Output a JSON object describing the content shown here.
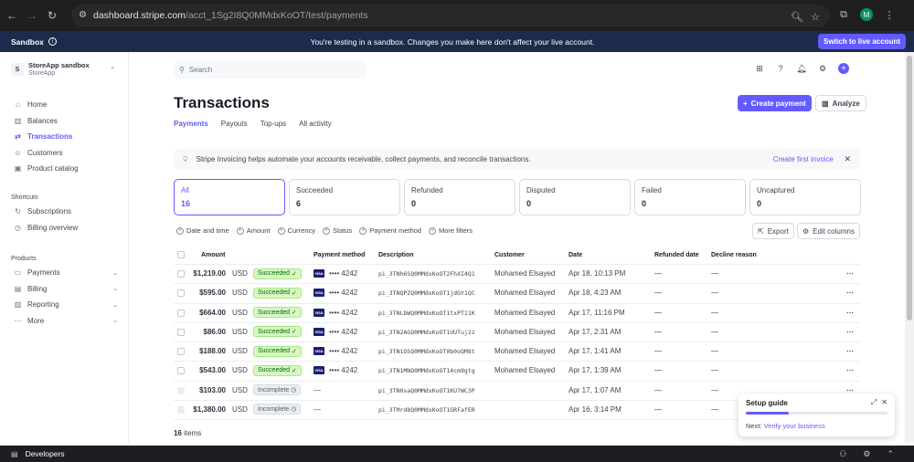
{
  "browser": {
    "url_host": "dashboard.stripe.com",
    "url_path": "/acct_1Sg2I8Q0MMdxKoOT/test/payments",
    "profile_initial": "M"
  },
  "sandbox": {
    "label": "Sandbox",
    "message": "You're testing in a sandbox. Changes you make here don't affect your live account.",
    "switch_label": "Switch to live account"
  },
  "account": {
    "logo": "S",
    "name": "StoreApp sandbox",
    "sub": "StoreApp"
  },
  "nav": {
    "main": [
      {
        "label": "Home",
        "icon": "home-icon",
        "glyph": "⌂"
      },
      {
        "label": "Balances",
        "icon": "bank-icon",
        "glyph": "▥"
      },
      {
        "label": "Transactions",
        "icon": "arrows-icon",
        "glyph": "⇄"
      },
      {
        "label": "Customers",
        "icon": "person-icon",
        "glyph": "☺"
      },
      {
        "label": "Product catalog",
        "icon": "box-icon",
        "glyph": "▣"
      }
    ],
    "shortcuts_heading": "Shortcuts",
    "shortcuts": [
      {
        "label": "Subscriptions",
        "glyph": "↻"
      },
      {
        "label": "Billing overview",
        "glyph": "◷"
      }
    ],
    "products_heading": "Products",
    "products": [
      {
        "label": "Payments",
        "glyph": "▭"
      },
      {
        "label": "Billing",
        "glyph": "▤"
      },
      {
        "label": "Reporting",
        "glyph": "▥"
      },
      {
        "label": "More",
        "glyph": "⋯"
      }
    ]
  },
  "search": {
    "placeholder": "Search"
  },
  "page": {
    "title": "Transactions",
    "create_label": "Create payment",
    "analyze_label": "Analyze",
    "tabs": [
      "Payments",
      "Payouts",
      "Top-ups",
      "All activity"
    ]
  },
  "banner": {
    "text": "Stripe Invoicing helps automate your accounts receivable, collect payments, and reconcile transactions.",
    "link": "Create first invoice"
  },
  "cards": [
    {
      "label": "All",
      "value": "16"
    },
    {
      "label": "Succeeded",
      "value": "6"
    },
    {
      "label": "Refunded",
      "value": "0"
    },
    {
      "label": "Disputed",
      "value": "0"
    },
    {
      "label": "Failed",
      "value": "0"
    },
    {
      "label": "Uncaptured",
      "value": "0"
    }
  ],
  "filters": [
    "Date and time",
    "Amount",
    "Currency",
    "Status",
    "Payment method",
    "More filters"
  ],
  "tools": {
    "export": "Export",
    "edit_columns": "Edit columns"
  },
  "table": {
    "headers": {
      "amount": "Amount",
      "payment_method": "Payment method",
      "description": "Description",
      "customer": "Customer",
      "date": "Date",
      "refunded_date": "Refunded date",
      "decline_reason": "Decline reason"
    },
    "rows": [
      {
        "amount": "$1,219.00",
        "currency": "USD",
        "status": "Succeeded",
        "status_type": "ok",
        "pm": "•••• 4242",
        "desc": "pi_3TNh6SQ0MMdxKoOT2FhXI4Q1",
        "customer": "Mohamed Elsayed",
        "date": "Apr 18, 10:13 PM",
        "refunded": "—",
        "decline": "—"
      },
      {
        "amount": "$595.00",
        "currency": "USD",
        "status": "Succeeded",
        "status_type": "ok",
        "pm": "•••• 4242",
        "desc": "pi_3TNQPZQ0MMdxKoOT1jdGY1QC",
        "customer": "Mohamed Elsayed",
        "date": "Apr 18, 4:23 AM",
        "refunded": "—",
        "decline": "—"
      },
      {
        "amount": "$664.00",
        "currency": "USD",
        "status": "Succeeded",
        "status_type": "ok",
        "pm": "•••• 4242",
        "desc": "pi_3TNLbWQ0MMdxKoOT1txPT11K",
        "customer": "Mohamed Elsayed",
        "date": "Apr 17, 11:16 PM",
        "refunded": "—",
        "decline": "—"
      },
      {
        "amount": "$86.00",
        "currency": "USD",
        "status": "Succeeded",
        "status_type": "ok",
        "pm": "•••• 4242",
        "desc": "pi_3TN2AGQ0MMdxKoOT1UUTuj2z",
        "customer": "Mohamed Elsayed",
        "date": "Apr 17, 2:31 AM",
        "refunded": "—",
        "decline": "—"
      },
      {
        "amount": "$188.00",
        "currency": "USD",
        "status": "Succeeded",
        "status_type": "ok",
        "pm": "•••• 4242",
        "desc": "pi_3TN1OSQ0MMdxKoOT0b0oQM8t",
        "customer": "Mohamed Elsayed",
        "date": "Apr 17, 1:41 AM",
        "refunded": "—",
        "decline": "—"
      },
      {
        "amount": "$543.00",
        "currency": "USD",
        "status": "Succeeded",
        "status_type": "ok",
        "pm": "•••• 4242",
        "desc": "pi_3TN1MNQ0MMdxKoOT14cm9gtg",
        "customer": "Mohamed Elsayed",
        "date": "Apr 17, 1:39 AM",
        "refunded": "—",
        "decline": "—"
      },
      {
        "amount": "$103.00",
        "currency": "USD",
        "status": "Incomplete",
        "status_type": "inc",
        "pm": "—",
        "desc": "pi_3TN0saQ0MMdxKoOT1KU7WC3P",
        "customer": "",
        "date": "Apr 17, 1:07 AM",
        "refunded": "—",
        "decline": "—"
      },
      {
        "amount": "$1,380.00",
        "currency": "USD",
        "status": "Incomplete",
        "status_type": "inc",
        "pm": "—",
        "desc": "pi_3TMrd8Q0MMdxKoOT1GRFafER",
        "customer": "",
        "date": "Apr 16, 3:14 PM",
        "refunded": "—",
        "decline": "—"
      }
    ]
  },
  "item_count": "16",
  "item_suffix": "items",
  "setup": {
    "title": "Setup guide",
    "next_prefix": "Next:",
    "next_link": "Verify your business",
    "progress": 0.3
  },
  "devbar": {
    "label": "Developers"
  },
  "colors": {
    "accent": "#635bff",
    "sandbox_bg": "#1c2b4b",
    "success_bg": "#d7f7c2"
  }
}
